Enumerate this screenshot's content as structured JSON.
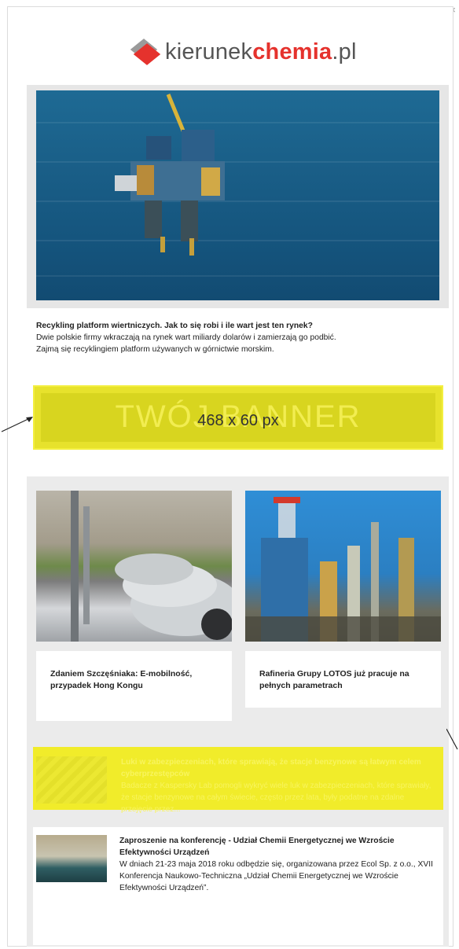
{
  "window": {
    "close_glyph": "×"
  },
  "logo": {
    "text_light_1": "kierunek",
    "text_bold": "chemia",
    "text_light_2": ".pl",
    "icon": "diamond-logo-icon",
    "accent_color": "#e5322d"
  },
  "hero": {
    "image": "offshore-platform-photo",
    "title": "Recykling platform wiertniczych. Jak to się robi i ile wart jest ten rynek?",
    "lines": [
      "Dwie polskie firmy wkraczają na rynek wart miliardy dolarów i zamierzają go podbić.",
      "Zajmą się recyklingiem platform używanych w górnictwie morskim."
    ]
  },
  "banner": {
    "ghost_text": "TWÓJ BANNER",
    "size_label": "468 x 60 px",
    "color": "#e7e22c"
  },
  "news": {
    "cards": [
      {
        "image": "electric-car-charging-photo",
        "title": "Zdaniem Szczęśniaka: E-mobilność, przypadek Hong Kongu"
      },
      {
        "image": "refinery-photo",
        "title": "Rafineria Grupy LOTOS już pracuje na pełnych parametrach"
      }
    ],
    "highlight": {
      "image": "keyboard-photo",
      "title": "Luki w zabezpieczeniach, które sprawiają, że stacje benzynowe są łatwym celem cyberprzestępców",
      "description": "Badacze z Kaspersky Lab pomogli wykryć wiele luk w zabezpieczeniach, które sprawiały, że stacje benzynowe na całym świecie, często przez lata, były podatne na zdalne przejęcie przez..."
    },
    "last": {
      "image": "conference-hall-photo",
      "title": "Zaproszenie na konferencję - Udział Chemii Energetycznej we Wzroście Efektywności Urządzeń",
      "description": "W dniach 21-23 maja 2018 roku odbędzie się, organizowana przez Ecol Sp. z o.o., XVII Konferencja Naukowo-Techniczna „Udział Chemii Energetycznej we Wzroście Efektywności Urządzeń”."
    }
  }
}
